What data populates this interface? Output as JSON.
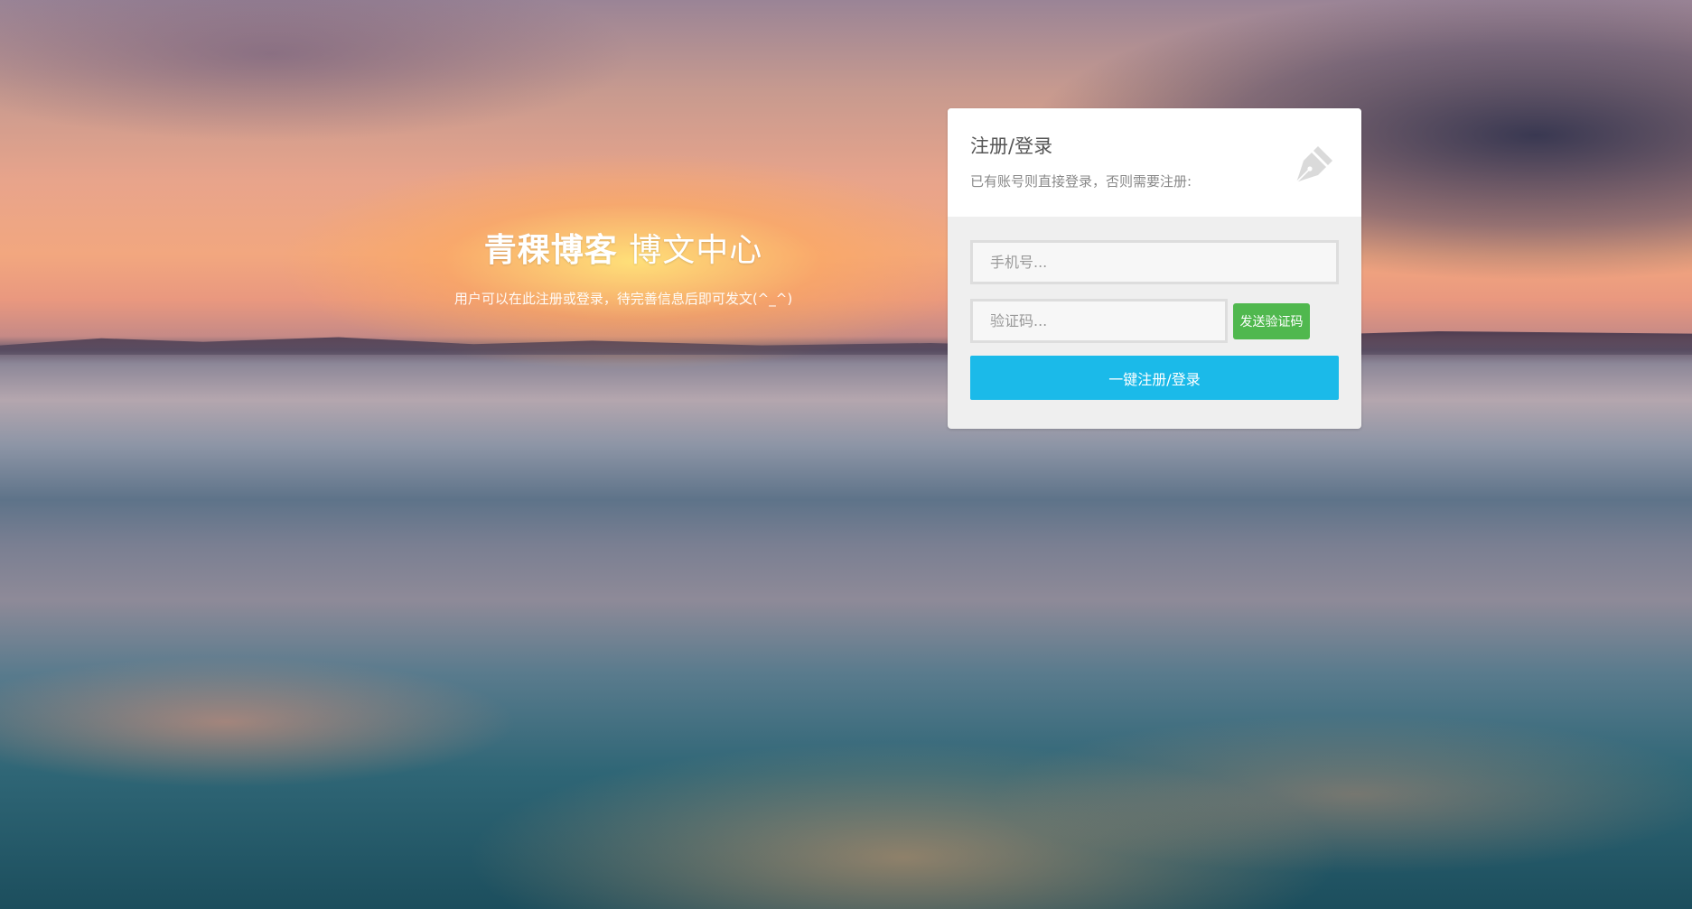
{
  "hero": {
    "title_bold": "青稞博客",
    "title_light": " 博文中心",
    "subtitle": "用户可以在此注册或登录，待完善信息后即可发文(^_^)"
  },
  "card": {
    "title": "注册/登录",
    "description": "已有账号则直接登录，否则需要注册:",
    "icon": "pen-icon",
    "phone_placeholder": "手机号...",
    "code_placeholder": "验证码...",
    "send_code_label": "发送验证码",
    "submit_label": "一键注册/登录"
  },
  "colors": {
    "send_button": "#50b84e",
    "submit_button": "#1bbae9",
    "card_header": "#ffffff",
    "card_body": "#efefef"
  }
}
